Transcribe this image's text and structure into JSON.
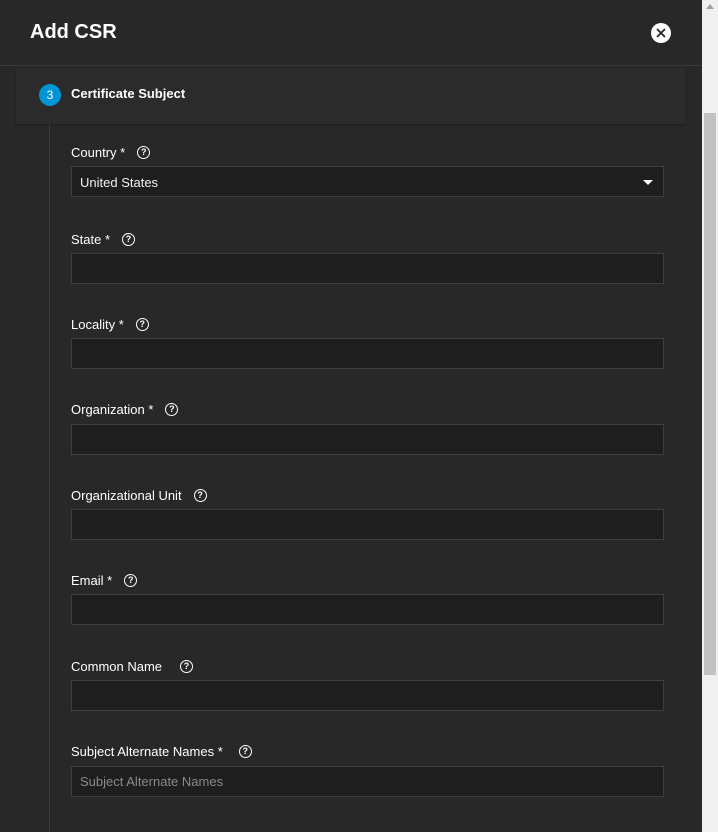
{
  "dialog": {
    "title": "Add CSR",
    "close_icon": "close-icon"
  },
  "step": {
    "number": "3",
    "label": "Certificate Subject"
  },
  "fields": {
    "country": {
      "label": "Country *",
      "value": "United States"
    },
    "state": {
      "label": "State *",
      "value": ""
    },
    "locality": {
      "label": "Locality *",
      "value": ""
    },
    "organization": {
      "label": "Organization *",
      "value": ""
    },
    "organizational_unit": {
      "label": "Organizational Unit",
      "value": ""
    },
    "email": {
      "label": "Email *",
      "value": ""
    },
    "common_name": {
      "label": "Common Name",
      "value": ""
    },
    "san": {
      "label": "Subject Alternate Names *",
      "value": "",
      "placeholder": "Subject Alternate Names"
    }
  },
  "colors": {
    "background": "#282828",
    "input_bg": "#1e1e1e",
    "accent": "#0095d5"
  },
  "help_glyph": "?"
}
